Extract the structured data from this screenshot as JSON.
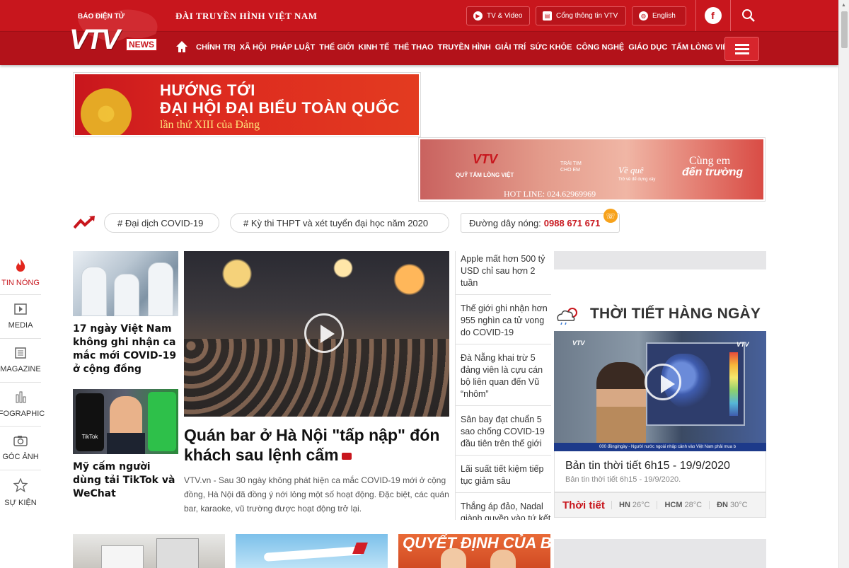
{
  "header": {
    "logo_small": "BÁO ĐIỆN TỬ",
    "logo_main": "VTV",
    "logo_news": "NEWS",
    "channel": "ĐÀI TRUYỀN HÌNH VIỆT NAM",
    "buttons": [
      {
        "label": "TV & Video",
        "icon": "play-icon"
      },
      {
        "label": "Cổng thông tin VTV",
        "icon": "portal-icon"
      },
      {
        "label": "English",
        "icon": "globe-icon"
      }
    ],
    "facebook": "f",
    "colors": {
      "brand": "#c8161d",
      "nav": "#b3121a",
      "accent": "#f7a21b"
    }
  },
  "nav": {
    "items": [
      "CHÍNH TRỊ",
      "XÃ HỘI",
      "PHÁP LUẬT",
      "THẾ GIỚI",
      "KINH TẾ",
      "THỂ THAO",
      "TRUYỀN HÌNH",
      "GIẢI TRÍ",
      "SỨC KHỎE",
      "CÔNG NGHỆ",
      "GIÁO DỤC",
      "TẤM LÒNG VIỆT"
    ]
  },
  "banners": {
    "party": {
      "line1": "HƯỚNG TỚI",
      "line2": "ĐẠI HỘI ĐẠI BIỂU TOÀN QUỐC",
      "line3": "lần thứ XIII của Đảng"
    },
    "charity": {
      "logo": "VTV",
      "fund": "QUỸ TẤM LÒNG VIỆT",
      "trai_tim": "TRÁI TIM CHO EM",
      "ve_que": "Về quê",
      "tro_ve": "Trở về để dựng xây",
      "cung_em": "Cùng em",
      "den_truong": "đến trường",
      "hotline": "HOT LINE: 024.62969969"
    }
  },
  "trending": {
    "tags": [
      "# Đại dịch COVID-19",
      "# Kỳ thi THPT và xét tuyển đại học năm 2020"
    ],
    "hotline_label": "Đường dây nóng:",
    "hotline_number": "0988 671 671"
  },
  "sidebar": {
    "items": [
      {
        "label": "TIN NÓNG",
        "icon": "fire-icon"
      },
      {
        "label": "MEDIA",
        "icon": "media-icon"
      },
      {
        "label": "MAGAZINE",
        "icon": "magazine-icon"
      },
      {
        "label": "INFOGRAPHIC",
        "icon": "infographic-icon"
      },
      {
        "label": "GÓC ẢNH",
        "icon": "camera-icon"
      },
      {
        "label": "SỰ KIỆN",
        "icon": "star-icon"
      }
    ]
  },
  "news": {
    "left": [
      {
        "title": "17 ngày Việt Nam không ghi nhận ca mắc mới COVID-19 ở cộng đồng"
      },
      {
        "title": "Mỹ cấm người dùng tải TikTok và WeChat"
      }
    ],
    "feature": {
      "title": "Quán bar ở Hà Nội \"tấp nập\" đón khách sau lệnh cấm",
      "desc": "VTV.vn - Sau 30 ngày không phát hiện ca mắc COVID-19 mới ở cộng đồng, Hà Nội đã đồng ý nới lỏng một số hoạt động. Đặc biệt, các quán bar, karaoke, vũ trường được hoạt động trở lại."
    },
    "list": [
      "Apple mất hơn 500 tỷ USD chỉ sau hơn 2 tuần",
      "Thế giới ghi nhận hơn 955 nghìn ca tử vong do COVID-19",
      "Đà Nẵng khai trừ 5 đảng viên là cựu cán bộ liên quan đến Vũ “nhôm”",
      "Sân bay đạt chuẩn 5 sao chống COVID-19 đầu tiên trên thế giới",
      "Lãi suất tiết kiệm tiếp tục giảm sâu",
      "Thắng áp đảo, Nadal giành quyền vào tứ kết"
    ]
  },
  "weather": {
    "heading": "THỜI TIẾT HÀNG NGÀY",
    "video_title": "Bản tin thời tiết 6h15 - 19/9/2020",
    "video_sub": "Bản tin thời tiết 6h15 - 19/9/2020.",
    "ticker": "000 đồng/ngày - Người nước ngoài nhập cảnh vào Việt Nam phải mua b",
    "bar_label": "Thời tiết",
    "cities": [
      {
        "code": "HN",
        "temp": "26°C"
      },
      {
        "code": "HCM",
        "temp": "28°C"
      },
      {
        "code": "ĐN",
        "temp": "30°C"
      }
    ]
  },
  "bottom": {
    "thumb3_text": "QUYẾT ĐỊNH CỦA BỘ"
  }
}
